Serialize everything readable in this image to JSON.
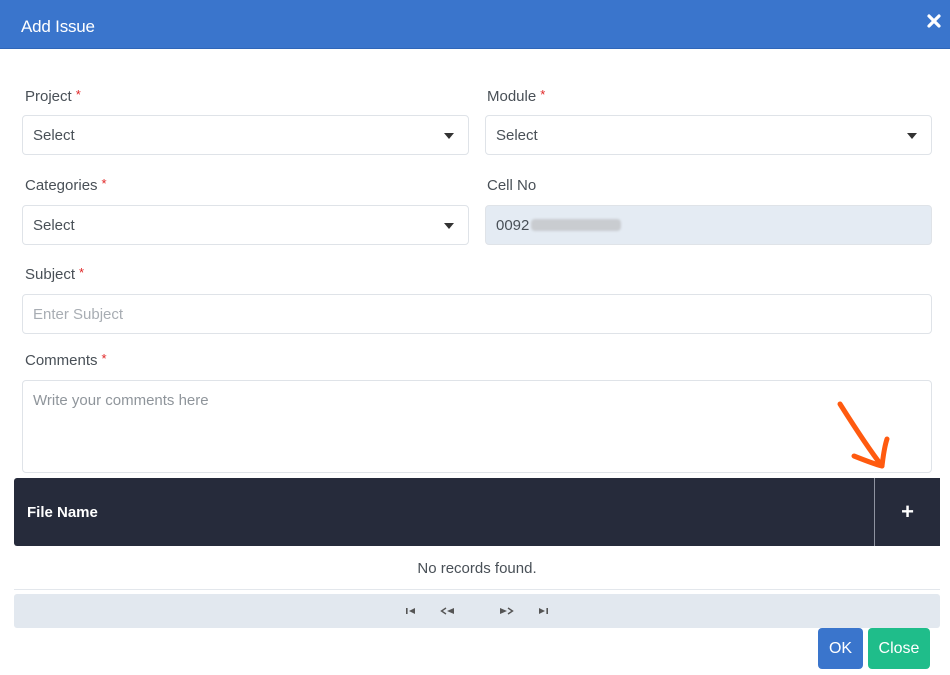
{
  "dialog": {
    "title": "Add Issue",
    "close_icon": "close-icon",
    "header_color": "#3a75cc"
  },
  "form": {
    "project": {
      "label": "Project",
      "required_mark": "*",
      "value": "Select"
    },
    "module": {
      "label": "Module",
      "required_mark": "*",
      "value": "Select"
    },
    "categories": {
      "label": "Categories",
      "required_mark": "*",
      "value": "Select"
    },
    "cell_no": {
      "label": "Cell No",
      "value_visible": "0092",
      "value_redacted": true
    },
    "subject": {
      "label": "Subject",
      "required_mark": "*",
      "placeholder": "Enter Subject",
      "value": ""
    },
    "comments": {
      "label": "Comments",
      "required_mark": "*",
      "placeholder": "Write your comments here",
      "value": ""
    }
  },
  "attachments": {
    "columns": [
      "File Name"
    ],
    "add_icon": "plus-icon",
    "add_label": "+",
    "empty_message": "No records found.",
    "paginator": {
      "icons": [
        "first-page-icon",
        "previous-page-icon",
        "next-page-icon",
        "last-page-icon"
      ]
    }
  },
  "footer": {
    "ok_label": "OK",
    "close_label": "Close",
    "ok_color": "#3a75cc",
    "close_color": "#1fbd8a"
  },
  "annotation": {
    "type": "arrow",
    "color": "#ff5a0f",
    "points_to": "add-file-button"
  }
}
